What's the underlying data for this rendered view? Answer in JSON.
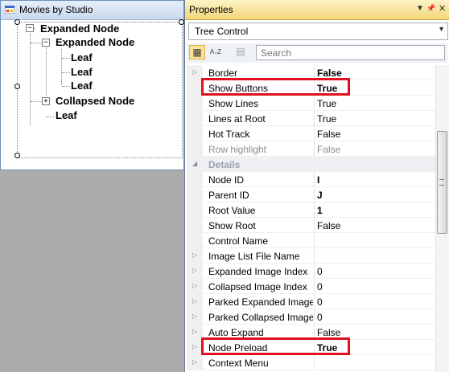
{
  "form": {
    "title": "Movies by Studio",
    "tree": [
      {
        "label": "Expanded Node"
      },
      {
        "label": "Expanded Node"
      },
      {
        "label": "Leaf"
      },
      {
        "label": "Leaf"
      },
      {
        "label": "Leaf"
      },
      {
        "label": "Collapsed Node"
      },
      {
        "label": "Leaf"
      }
    ],
    "expand_glyph": "−",
    "collapse_glyph": "+"
  },
  "props": {
    "title": "Properties",
    "title_controls": [
      "▼",
      "📌",
      "✕"
    ],
    "object": "Tree Control",
    "search_placeholder": "Search",
    "toolbar": {
      "categorized": "▦",
      "alphabetical": "A↓Z",
      "pages": "▤"
    },
    "rows": [
      {
        "name": "Border",
        "value": "False"
      },
      {
        "name": "Show Buttons",
        "value": "True"
      },
      {
        "name": "Show Lines",
        "value": "True"
      },
      {
        "name": "Lines at Root",
        "value": "True"
      },
      {
        "name": "Hot Track",
        "value": "False"
      },
      {
        "name": "Row highlight",
        "value": "False"
      },
      {
        "name": "Details",
        "value": ""
      },
      {
        "name": "Node ID",
        "value": "I"
      },
      {
        "name": "Parent ID",
        "value": "J"
      },
      {
        "name": "Root Value",
        "value": "1"
      },
      {
        "name": "Show Root",
        "value": "False"
      },
      {
        "name": "Control Name",
        "value": ""
      },
      {
        "name": "Image List File Name",
        "value": ""
      },
      {
        "name": "Expanded Image Index",
        "value": "0"
      },
      {
        "name": "Collapsed Image Index",
        "value": "0"
      },
      {
        "name": "Parked Expanded Image In",
        "value": "0"
      },
      {
        "name": "Parked Collapsed Image In",
        "value": "0"
      },
      {
        "name": "Auto Expand",
        "value": "False"
      },
      {
        "name": "Node Preload",
        "value": "True"
      },
      {
        "name": "Context Menu",
        "value": ""
      }
    ],
    "glyphs": {
      "collapsed": "▷",
      "expanded": "◢"
    },
    "highlight_color": "#e0101f",
    "titlebar_color": "#f3d67a"
  }
}
